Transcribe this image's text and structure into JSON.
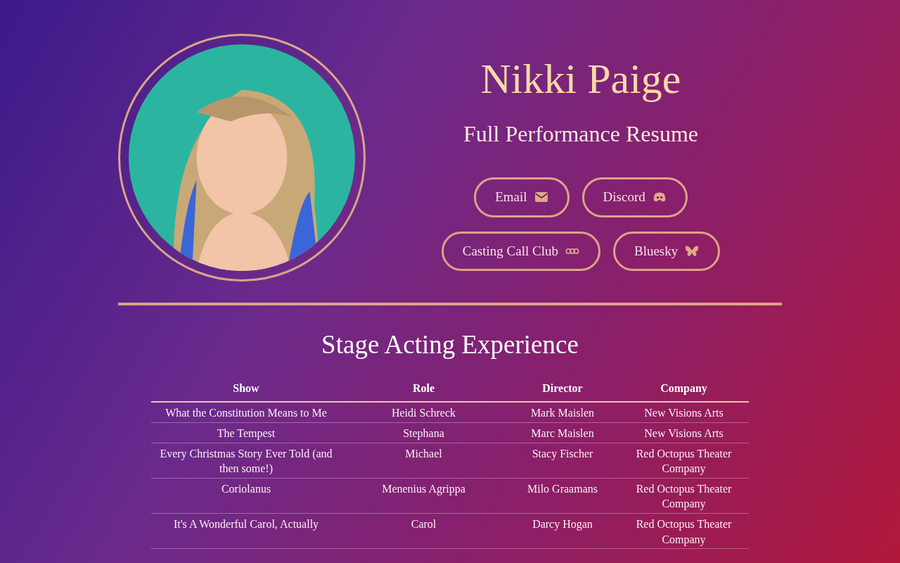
{
  "profile": {
    "name": "Nikki Paige",
    "subtitle": "Full Performance Resume"
  },
  "links": [
    {
      "label": "Email",
      "kind": "email"
    },
    {
      "label": "Discord",
      "kind": "discord"
    },
    {
      "label": "Casting Call Club",
      "kind": "ccc"
    },
    {
      "label": "Bluesky",
      "kind": "bluesky"
    }
  ],
  "section": {
    "title": "Stage Acting Experience"
  },
  "table": {
    "columns": [
      "Show",
      "Role",
      "Director",
      "Company"
    ],
    "rows": [
      [
        "What the Constitution Means to Me",
        "Heidi Schreck",
        "Mark Maislen",
        "New Visions Arts"
      ],
      [
        "The Tempest",
        "Stephana",
        "Marc Maislen",
        "New Visions Arts"
      ],
      [
        "Every Christmas Story Ever Told (and then some!)",
        "Michael",
        "Stacy Fischer",
        "Red Octopus Theater Company"
      ],
      [
        "Coriolanus",
        "Menenius Agrippa",
        "Milo Graamans",
        "Red Octopus Theater Company"
      ],
      [
        "It's A Wonderful Carol, Actually",
        "Carol",
        "Darcy Hogan",
        "Red Octopus Theater Company"
      ]
    ]
  }
}
